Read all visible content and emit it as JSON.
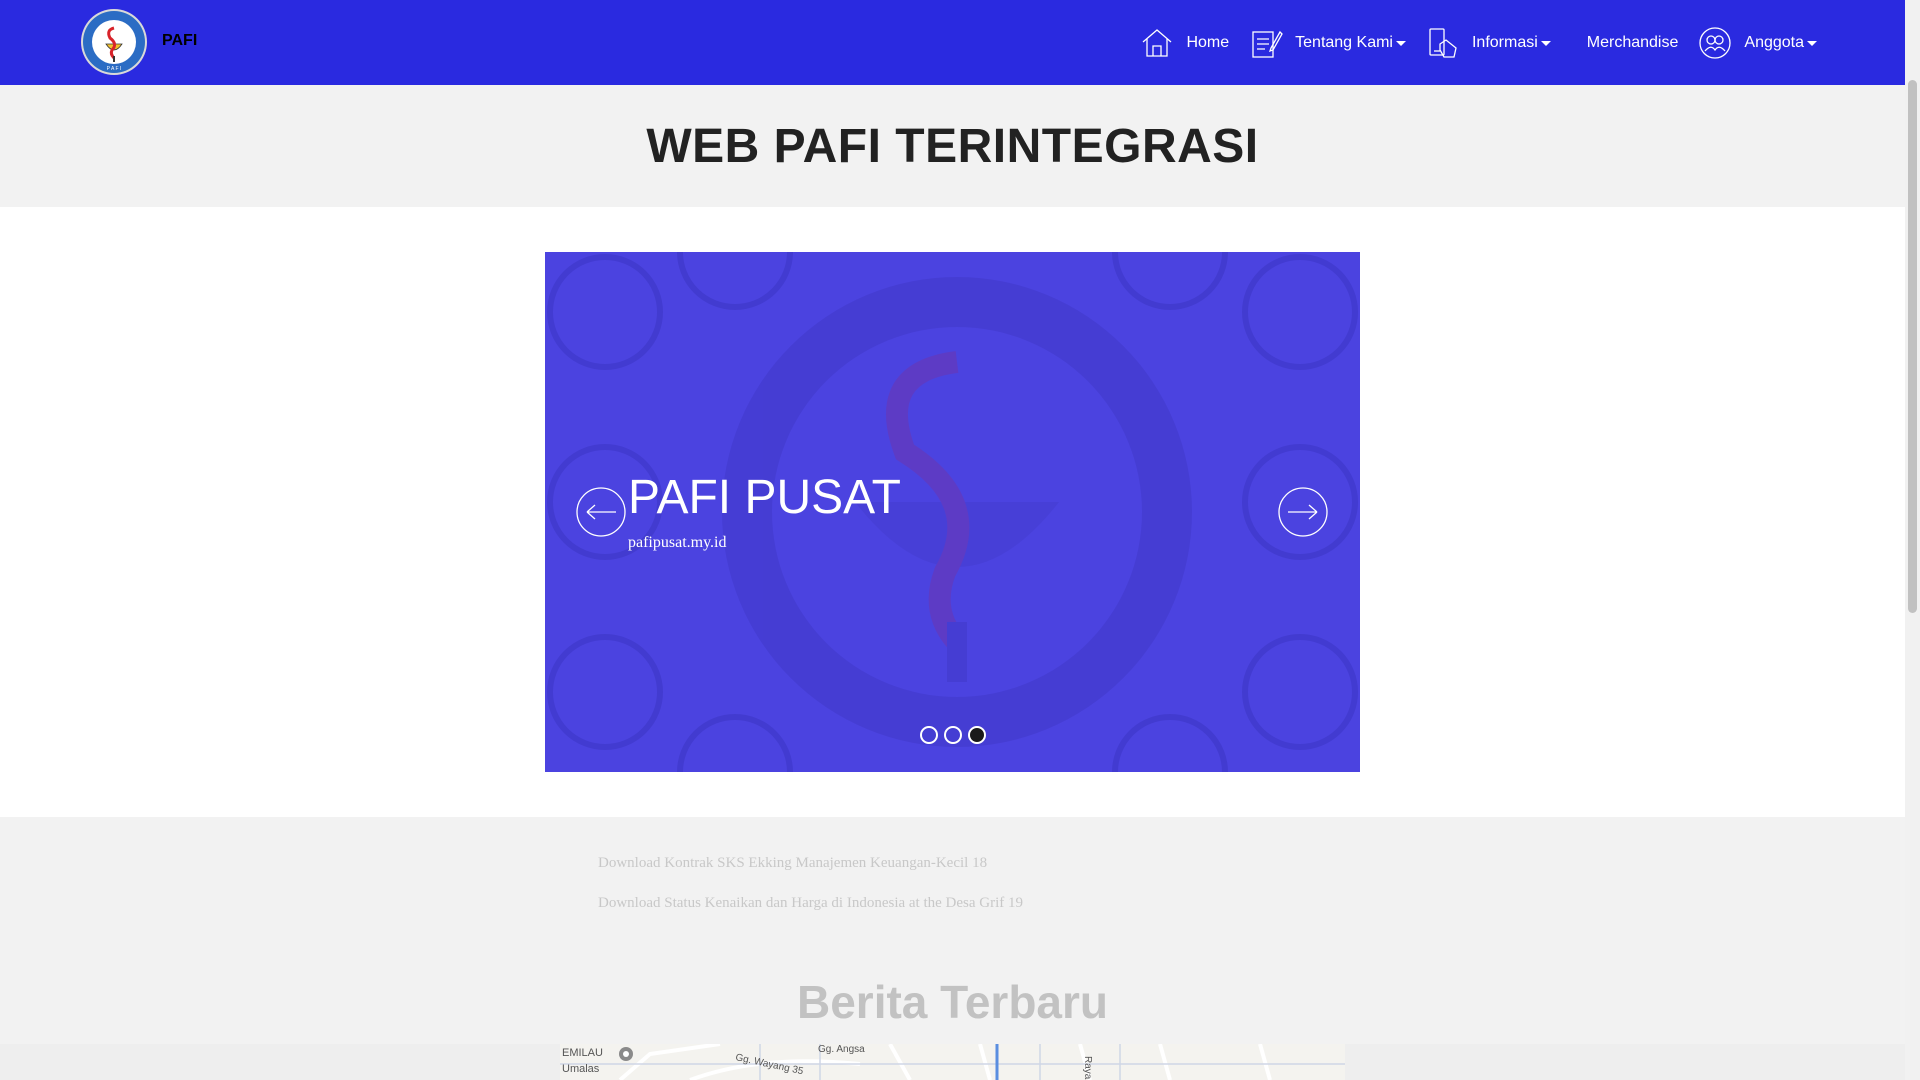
{
  "brand": {
    "name": "PAFI",
    "logo_text": "PERSATUAN AHLI FARMASI INDONESIA",
    "logo_letters": "P A F I"
  },
  "nav": {
    "items": [
      {
        "label": "Home",
        "icon": "home-icon",
        "dropdown": false
      },
      {
        "label": "Tentang Kami",
        "icon": "edit-document-icon",
        "dropdown": true
      },
      {
        "label": "Informasi",
        "icon": "mobile-touch-icon",
        "dropdown": true
      },
      {
        "label": "Merchandise",
        "icon": "",
        "dropdown": false
      },
      {
        "label": "Anggota",
        "icon": "users-circle-icon",
        "dropdown": true
      }
    ]
  },
  "page_title": "WEB PAFI TERINTEGRASI",
  "carousel": {
    "slide_title": "PAFI PUSAT",
    "slide_subtitle": "pafipusat.my.id",
    "slide_count": 3,
    "active_index": 2,
    "background_color": "#4b43e0"
  },
  "news": {
    "ticker": [
      "Download Kontrak SKS Ekking Manajemen Keuangan-Kecil 18",
      "Download Status Kenaikan dan Harga di Indonesia at the Desa Grif 19"
    ],
    "section_title": "Berita Terbaru"
  },
  "map": {
    "labels": [
      "EMILAU",
      "Umalas",
      "Gg. Angsa",
      "Gg. Wayang 35",
      "Raya"
    ]
  },
  "colors": {
    "nav_bg": "#2a2ae0",
    "band_bg": "#f2f2f2",
    "title": "#222222"
  }
}
